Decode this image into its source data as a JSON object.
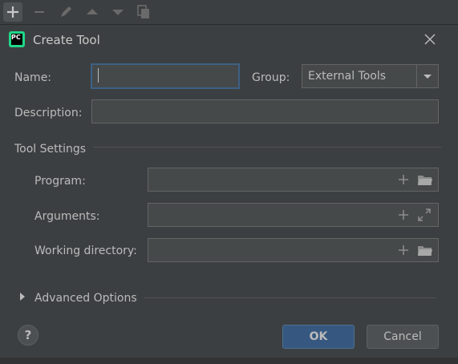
{
  "toolbar": {
    "items": [
      "add-icon",
      "remove-icon",
      "edit-icon",
      "move-up-icon",
      "move-down-icon",
      "copy-icon"
    ]
  },
  "dialog": {
    "title": "Create Tool",
    "name_label": "Name:",
    "name_value": "",
    "group_label": "Group:",
    "group_value": "External Tools",
    "description_label": "Description:",
    "description_value": "",
    "tool_settings_label": "Tool Settings",
    "program_label": "Program:",
    "program_value": "",
    "arguments_label": "Arguments:",
    "arguments_value": "",
    "working_dir_label": "Working directory:",
    "working_dir_value": "",
    "advanced_label": "Advanced Options",
    "ok_label": "OK",
    "cancel_label": "Cancel",
    "help_label": "?"
  },
  "app_icon_text": "PC",
  "colors": {
    "background": "#3c3f41",
    "field": "#45494a",
    "focus_border": "#3d6185",
    "ok_button": "#365880",
    "text": "#bbbbbb"
  }
}
